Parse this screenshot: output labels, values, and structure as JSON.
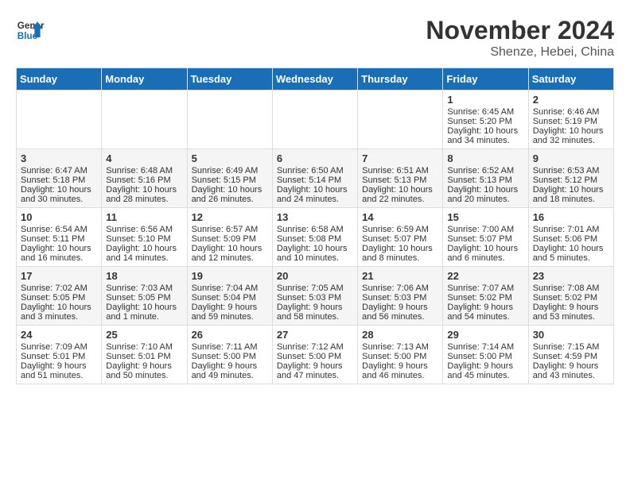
{
  "header": {
    "logo_general": "General",
    "logo_blue": "Blue",
    "month_title": "November 2024",
    "location": "Shenze, Hebei, China"
  },
  "weekdays": [
    "Sunday",
    "Monday",
    "Tuesday",
    "Wednesday",
    "Thursday",
    "Friday",
    "Saturday"
  ],
  "weeks": [
    [
      {
        "day": "",
        "sunrise": "",
        "sunset": "",
        "daylight": ""
      },
      {
        "day": "",
        "sunrise": "",
        "sunset": "",
        "daylight": ""
      },
      {
        "day": "",
        "sunrise": "",
        "sunset": "",
        "daylight": ""
      },
      {
        "day": "",
        "sunrise": "",
        "sunset": "",
        "daylight": ""
      },
      {
        "day": "",
        "sunrise": "",
        "sunset": "",
        "daylight": ""
      },
      {
        "day": "1",
        "sunrise": "Sunrise: 6:45 AM",
        "sunset": "Sunset: 5:20 PM",
        "daylight": "Daylight: 10 hours and 34 minutes."
      },
      {
        "day": "2",
        "sunrise": "Sunrise: 6:46 AM",
        "sunset": "Sunset: 5:19 PM",
        "daylight": "Daylight: 10 hours and 32 minutes."
      }
    ],
    [
      {
        "day": "3",
        "sunrise": "Sunrise: 6:47 AM",
        "sunset": "Sunset: 5:18 PM",
        "daylight": "Daylight: 10 hours and 30 minutes."
      },
      {
        "day": "4",
        "sunrise": "Sunrise: 6:48 AM",
        "sunset": "Sunset: 5:16 PM",
        "daylight": "Daylight: 10 hours and 28 minutes."
      },
      {
        "day": "5",
        "sunrise": "Sunrise: 6:49 AM",
        "sunset": "Sunset: 5:15 PM",
        "daylight": "Daylight: 10 hours and 26 minutes."
      },
      {
        "day": "6",
        "sunrise": "Sunrise: 6:50 AM",
        "sunset": "Sunset: 5:14 PM",
        "daylight": "Daylight: 10 hours and 24 minutes."
      },
      {
        "day": "7",
        "sunrise": "Sunrise: 6:51 AM",
        "sunset": "Sunset: 5:13 PM",
        "daylight": "Daylight: 10 hours and 22 minutes."
      },
      {
        "day": "8",
        "sunrise": "Sunrise: 6:52 AM",
        "sunset": "Sunset: 5:13 PM",
        "daylight": "Daylight: 10 hours and 20 minutes."
      },
      {
        "day": "9",
        "sunrise": "Sunrise: 6:53 AM",
        "sunset": "Sunset: 5:12 PM",
        "daylight": "Daylight: 10 hours and 18 minutes."
      }
    ],
    [
      {
        "day": "10",
        "sunrise": "Sunrise: 6:54 AM",
        "sunset": "Sunset: 5:11 PM",
        "daylight": "Daylight: 10 hours and 16 minutes."
      },
      {
        "day": "11",
        "sunrise": "Sunrise: 6:56 AM",
        "sunset": "Sunset: 5:10 PM",
        "daylight": "Daylight: 10 hours and 14 minutes."
      },
      {
        "day": "12",
        "sunrise": "Sunrise: 6:57 AM",
        "sunset": "Sunset: 5:09 PM",
        "daylight": "Daylight: 10 hours and 12 minutes."
      },
      {
        "day": "13",
        "sunrise": "Sunrise: 6:58 AM",
        "sunset": "Sunset: 5:08 PM",
        "daylight": "Daylight: 10 hours and 10 minutes."
      },
      {
        "day": "14",
        "sunrise": "Sunrise: 6:59 AM",
        "sunset": "Sunset: 5:07 PM",
        "daylight": "Daylight: 10 hours and 8 minutes."
      },
      {
        "day": "15",
        "sunrise": "Sunrise: 7:00 AM",
        "sunset": "Sunset: 5:07 PM",
        "daylight": "Daylight: 10 hours and 6 minutes."
      },
      {
        "day": "16",
        "sunrise": "Sunrise: 7:01 AM",
        "sunset": "Sunset: 5:06 PM",
        "daylight": "Daylight: 10 hours and 5 minutes."
      }
    ],
    [
      {
        "day": "17",
        "sunrise": "Sunrise: 7:02 AM",
        "sunset": "Sunset: 5:05 PM",
        "daylight": "Daylight: 10 hours and 3 minutes."
      },
      {
        "day": "18",
        "sunrise": "Sunrise: 7:03 AM",
        "sunset": "Sunset: 5:05 PM",
        "daylight": "Daylight: 10 hours and 1 minute."
      },
      {
        "day": "19",
        "sunrise": "Sunrise: 7:04 AM",
        "sunset": "Sunset: 5:04 PM",
        "daylight": "Daylight: 9 hours and 59 minutes."
      },
      {
        "day": "20",
        "sunrise": "Sunrise: 7:05 AM",
        "sunset": "Sunset: 5:03 PM",
        "daylight": "Daylight: 9 hours and 58 minutes."
      },
      {
        "day": "21",
        "sunrise": "Sunrise: 7:06 AM",
        "sunset": "Sunset: 5:03 PM",
        "daylight": "Daylight: 9 hours and 56 minutes."
      },
      {
        "day": "22",
        "sunrise": "Sunrise: 7:07 AM",
        "sunset": "Sunset: 5:02 PM",
        "daylight": "Daylight: 9 hours and 54 minutes."
      },
      {
        "day": "23",
        "sunrise": "Sunrise: 7:08 AM",
        "sunset": "Sunset: 5:02 PM",
        "daylight": "Daylight: 9 hours and 53 minutes."
      }
    ],
    [
      {
        "day": "24",
        "sunrise": "Sunrise: 7:09 AM",
        "sunset": "Sunset: 5:01 PM",
        "daylight": "Daylight: 9 hours and 51 minutes."
      },
      {
        "day": "25",
        "sunrise": "Sunrise: 7:10 AM",
        "sunset": "Sunset: 5:01 PM",
        "daylight": "Daylight: 9 hours and 50 minutes."
      },
      {
        "day": "26",
        "sunrise": "Sunrise: 7:11 AM",
        "sunset": "Sunset: 5:00 PM",
        "daylight": "Daylight: 9 hours and 49 minutes."
      },
      {
        "day": "27",
        "sunrise": "Sunrise: 7:12 AM",
        "sunset": "Sunset: 5:00 PM",
        "daylight": "Daylight: 9 hours and 47 minutes."
      },
      {
        "day": "28",
        "sunrise": "Sunrise: 7:13 AM",
        "sunset": "Sunset: 5:00 PM",
        "daylight": "Daylight: 9 hours and 46 minutes."
      },
      {
        "day": "29",
        "sunrise": "Sunrise: 7:14 AM",
        "sunset": "Sunset: 5:00 PM",
        "daylight": "Daylight: 9 hours and 45 minutes."
      },
      {
        "day": "30",
        "sunrise": "Sunrise: 7:15 AM",
        "sunset": "Sunset: 4:59 PM",
        "daylight": "Daylight: 9 hours and 43 minutes."
      }
    ]
  ]
}
